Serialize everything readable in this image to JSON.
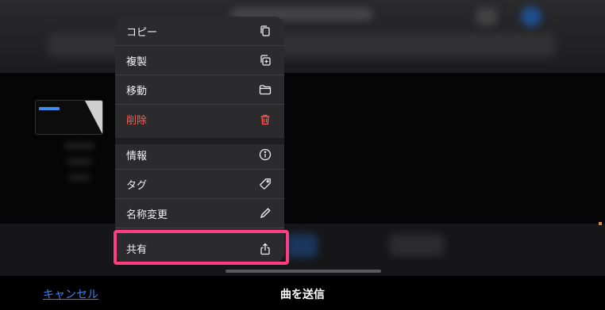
{
  "menu": {
    "items": [
      {
        "label": "コピー",
        "icon": "copy-icon"
      },
      {
        "label": "複製",
        "icon": "duplicate-icon"
      },
      {
        "label": "移動",
        "icon": "folder-icon"
      },
      {
        "label": "削除",
        "icon": "trash-icon",
        "destructive": true
      },
      {
        "label": "情報",
        "icon": "info-icon"
      },
      {
        "label": "タグ",
        "icon": "tag-icon"
      },
      {
        "label": "名称変更",
        "icon": "pencil-icon"
      },
      {
        "label": "共有",
        "icon": "share-icon"
      }
    ]
  },
  "footer": {
    "cancel_label": "キャンセル",
    "title": "曲を送信"
  },
  "colors": {
    "destructive": "#ff5a52",
    "highlight": "#ff3d7f",
    "link": "#3d7ff0"
  }
}
